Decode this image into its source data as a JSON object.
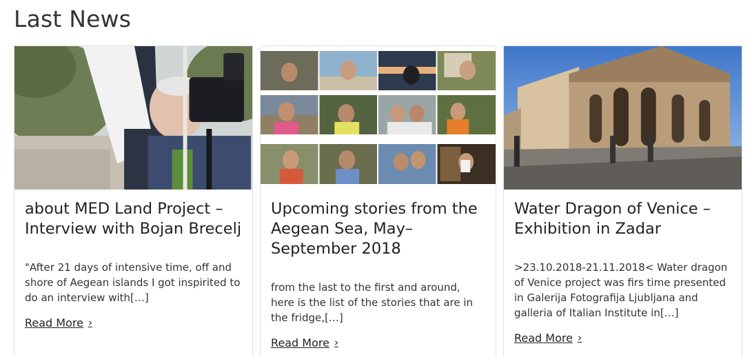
{
  "section": {
    "title": "Last News"
  },
  "cards": [
    {
      "title": "about MED Land Project – Interview with Bojan Brecelj",
      "excerpt": "\"After 21 days of intensive time, off and shore of Aegean  islands I got inspirited to do an interview with[…]",
      "read_more": "Read More",
      "image": "photographer-with-camera-photo"
    },
    {
      "title": "Upcoming stories from the Aegean Sea, May–September 2018",
      "excerpt": "from the last to the first and around, here is the list of the stories that are in the fridge,[…]",
      "read_more": "Read More",
      "image": "portrait-collage-photo"
    },
    {
      "title": "Water Dragon of Venice – Exhibition in Zadar",
      "excerpt": ">23.10.2018-21.11.2018< Water dragon of Venice project was firs time presented in Galerija Fotografija Ljubljana and galleria of Italian Institute in[…]",
      "read_more": "Read More",
      "image": "venetian-building-square-photo"
    }
  ],
  "icons": {
    "read_more": "chevron-right-icon"
  },
  "colors": {
    "text": "#222222",
    "border": "#e2e2e2",
    "background": "#ffffff"
  }
}
